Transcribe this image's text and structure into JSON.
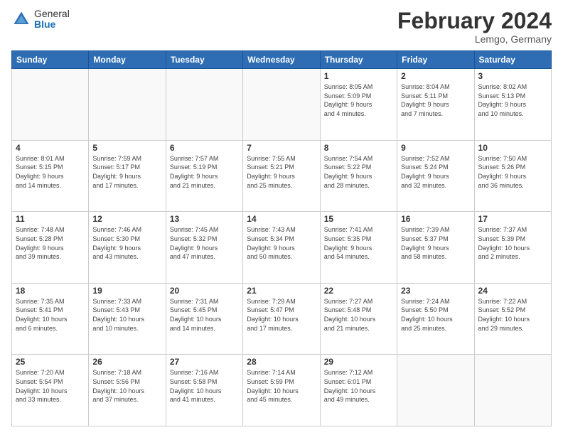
{
  "logo": {
    "general": "General",
    "blue": "Blue"
  },
  "title": "February 2024",
  "subtitle": "Lemgo, Germany",
  "days_header": [
    "Sunday",
    "Monday",
    "Tuesday",
    "Wednesday",
    "Thursday",
    "Friday",
    "Saturday"
  ],
  "weeks": [
    [
      {
        "day": "",
        "info": ""
      },
      {
        "day": "",
        "info": ""
      },
      {
        "day": "",
        "info": ""
      },
      {
        "day": "",
        "info": ""
      },
      {
        "day": "1",
        "info": "Sunrise: 8:05 AM\nSunset: 5:09 PM\nDaylight: 9 hours\nand 4 minutes."
      },
      {
        "day": "2",
        "info": "Sunrise: 8:04 AM\nSunset: 5:11 PM\nDaylight: 9 hours\nand 7 minutes."
      },
      {
        "day": "3",
        "info": "Sunrise: 8:02 AM\nSunset: 5:13 PM\nDaylight: 9 hours\nand 10 minutes."
      }
    ],
    [
      {
        "day": "4",
        "info": "Sunrise: 8:01 AM\nSunset: 5:15 PM\nDaylight: 9 hours\nand 14 minutes."
      },
      {
        "day": "5",
        "info": "Sunrise: 7:59 AM\nSunset: 5:17 PM\nDaylight: 9 hours\nand 17 minutes."
      },
      {
        "day": "6",
        "info": "Sunrise: 7:57 AM\nSunset: 5:19 PM\nDaylight: 9 hours\nand 21 minutes."
      },
      {
        "day": "7",
        "info": "Sunrise: 7:55 AM\nSunset: 5:21 PM\nDaylight: 9 hours\nand 25 minutes."
      },
      {
        "day": "8",
        "info": "Sunrise: 7:54 AM\nSunset: 5:22 PM\nDaylight: 9 hours\nand 28 minutes."
      },
      {
        "day": "9",
        "info": "Sunrise: 7:52 AM\nSunset: 5:24 PM\nDaylight: 9 hours\nand 32 minutes."
      },
      {
        "day": "10",
        "info": "Sunrise: 7:50 AM\nSunset: 5:26 PM\nDaylight: 9 hours\nand 36 minutes."
      }
    ],
    [
      {
        "day": "11",
        "info": "Sunrise: 7:48 AM\nSunset: 5:28 PM\nDaylight: 9 hours\nand 39 minutes."
      },
      {
        "day": "12",
        "info": "Sunrise: 7:46 AM\nSunset: 5:30 PM\nDaylight: 9 hours\nand 43 minutes."
      },
      {
        "day": "13",
        "info": "Sunrise: 7:45 AM\nSunset: 5:32 PM\nDaylight: 9 hours\nand 47 minutes."
      },
      {
        "day": "14",
        "info": "Sunrise: 7:43 AM\nSunset: 5:34 PM\nDaylight: 9 hours\nand 50 minutes."
      },
      {
        "day": "15",
        "info": "Sunrise: 7:41 AM\nSunset: 5:35 PM\nDaylight: 9 hours\nand 54 minutes."
      },
      {
        "day": "16",
        "info": "Sunrise: 7:39 AM\nSunset: 5:37 PM\nDaylight: 9 hours\nand 58 minutes."
      },
      {
        "day": "17",
        "info": "Sunrise: 7:37 AM\nSunset: 5:39 PM\nDaylight: 10 hours\nand 2 minutes."
      }
    ],
    [
      {
        "day": "18",
        "info": "Sunrise: 7:35 AM\nSunset: 5:41 PM\nDaylight: 10 hours\nand 6 minutes."
      },
      {
        "day": "19",
        "info": "Sunrise: 7:33 AM\nSunset: 5:43 PM\nDaylight: 10 hours\nand 10 minutes."
      },
      {
        "day": "20",
        "info": "Sunrise: 7:31 AM\nSunset: 5:45 PM\nDaylight: 10 hours\nand 14 minutes."
      },
      {
        "day": "21",
        "info": "Sunrise: 7:29 AM\nSunset: 5:47 PM\nDaylight: 10 hours\nand 17 minutes."
      },
      {
        "day": "22",
        "info": "Sunrise: 7:27 AM\nSunset: 5:48 PM\nDaylight: 10 hours\nand 21 minutes."
      },
      {
        "day": "23",
        "info": "Sunrise: 7:24 AM\nSunset: 5:50 PM\nDaylight: 10 hours\nand 25 minutes."
      },
      {
        "day": "24",
        "info": "Sunrise: 7:22 AM\nSunset: 5:52 PM\nDaylight: 10 hours\nand 29 minutes."
      }
    ],
    [
      {
        "day": "25",
        "info": "Sunrise: 7:20 AM\nSunset: 5:54 PM\nDaylight: 10 hours\nand 33 minutes."
      },
      {
        "day": "26",
        "info": "Sunrise: 7:18 AM\nSunset: 5:56 PM\nDaylight: 10 hours\nand 37 minutes."
      },
      {
        "day": "27",
        "info": "Sunrise: 7:16 AM\nSunset: 5:58 PM\nDaylight: 10 hours\nand 41 minutes."
      },
      {
        "day": "28",
        "info": "Sunrise: 7:14 AM\nSunset: 5:59 PM\nDaylight: 10 hours\nand 45 minutes."
      },
      {
        "day": "29",
        "info": "Sunrise: 7:12 AM\nSunset: 6:01 PM\nDaylight: 10 hours\nand 49 minutes."
      },
      {
        "day": "",
        "info": ""
      },
      {
        "day": "",
        "info": ""
      }
    ]
  ]
}
